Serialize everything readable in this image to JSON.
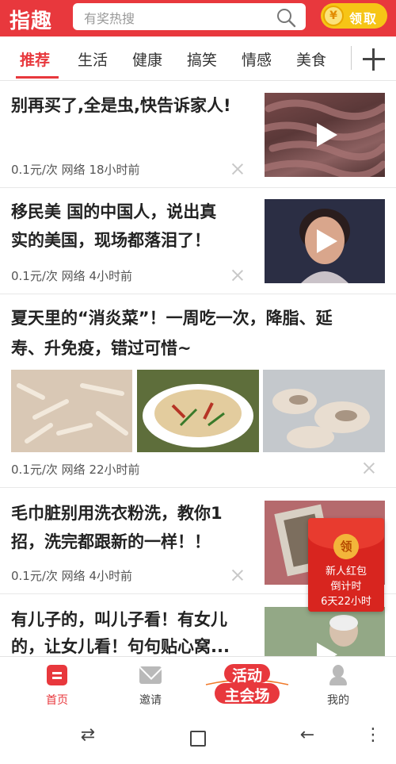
{
  "header": {
    "logo": "指趣",
    "search_placeholder": "有奖热搜",
    "claim_coin": "¥",
    "claim_label": "领取"
  },
  "tabs": [
    "推荐",
    "生活",
    "健康",
    "搞笑",
    "情感",
    "美食"
  ],
  "feed": [
    {
      "title_lines": [
        "别再买了,全是虫,快告诉家人!"
      ],
      "meta": "0.1元/次 网络 18小时前",
      "has_video": true
    },
    {
      "title_lines": [
        "移民美 国的中国人，说出真",
        "实的美国，现场都落泪了！"
      ],
      "meta": "0.1元/次 网络 4小时前",
      "has_video": true
    },
    {
      "title_lines": [
        "夏天里的“消炎菜”！一周吃一次，降脂、延",
        "寿、升免疫，错过可惜~"
      ],
      "meta": "0.1元/次 网络 22小时前",
      "has_video": false
    },
    {
      "title_lines": [
        "毛巾脏别用洗衣粉洗，教你1",
        "招，洗完都跟新的一样！！"
      ],
      "meta": "0.1元/次 网络 4小时前",
      "has_video": true
    },
    {
      "title_lines": [
        "有儿子的，叫儿子看！有女儿",
        "的，让女儿看！句句贴心窝..."
      ],
      "has_video": true
    }
  ],
  "envelope": {
    "seal": "领",
    "line1": "新人红包",
    "line2": "倒计时",
    "line3": "6天22小时"
  },
  "bottom_nav": {
    "home": "首页",
    "invite": "邀请",
    "event_line1": "活动",
    "event_line2": "主会场",
    "me": "我的"
  },
  "system_nav": {
    "recents_glyph": "⇄",
    "back_glyph": "←",
    "menu_glyph": "⋮"
  },
  "colors": {
    "brand_red": "#e8383d",
    "coin_yellow": "#f6c516"
  }
}
